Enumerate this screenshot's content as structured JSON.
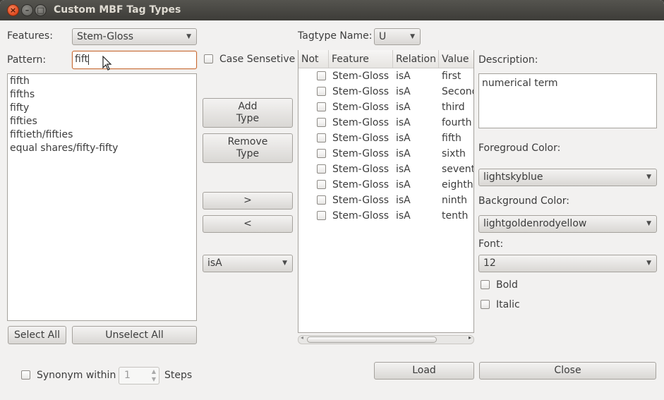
{
  "window": {
    "title": "Custom MBF Tag Types"
  },
  "features": {
    "label": "Features:",
    "value": "Stem-Gloss"
  },
  "pattern": {
    "label": "Pattern:",
    "value": "fift"
  },
  "case_sensitive": {
    "label": "Case Sensetive"
  },
  "matches": [
    "fifth",
    "fifths",
    "fifty",
    "fifties",
    "fiftieth/fifties",
    "equal shares/fifty-fifty"
  ],
  "buttons": {
    "add_type": [
      "Add",
      "Type"
    ],
    "remove_type": [
      "Remove",
      "Type"
    ],
    "move_right": ">",
    "move_left": "<",
    "select_all": "Select All",
    "unselect_all": "Unselect All",
    "load": "Load",
    "close": "Close"
  },
  "relation_combo": {
    "value": "isA"
  },
  "tagtype": {
    "label": "Tagtype Name:",
    "value": "U"
  },
  "table": {
    "columns": [
      "Not",
      "Feature",
      "Relation",
      "Value"
    ],
    "rows": [
      {
        "feature": "Stem-Gloss",
        "relation": "isA",
        "value": "first"
      },
      {
        "feature": "Stem-Gloss",
        "relation": "isA",
        "value": "Second"
      },
      {
        "feature": "Stem-Gloss",
        "relation": "isA",
        "value": "third"
      },
      {
        "feature": "Stem-Gloss",
        "relation": "isA",
        "value": "fourth"
      },
      {
        "feature": "Stem-Gloss",
        "relation": "isA",
        "value": "fifth"
      },
      {
        "feature": "Stem-Gloss",
        "relation": "isA",
        "value": "sixth"
      },
      {
        "feature": "Stem-Gloss",
        "relation": "isA",
        "value": "seventh"
      },
      {
        "feature": "Stem-Gloss",
        "relation": "isA",
        "value": "eighth"
      },
      {
        "feature": "Stem-Gloss",
        "relation": "isA",
        "value": "ninth"
      },
      {
        "feature": "Stem-Gloss",
        "relation": "isA",
        "value": "tenth"
      }
    ]
  },
  "description": {
    "label": "Description:",
    "value": "numerical term"
  },
  "foreground": {
    "label": "Foregroud Color:",
    "value": "lightskyblue"
  },
  "background": {
    "label": "Background Color:",
    "value": "lightgoldenrodyellow"
  },
  "font": {
    "label": "Font:",
    "value": "12"
  },
  "bold": {
    "label": "Bold"
  },
  "italic": {
    "label": "Italic"
  },
  "synonym": {
    "label": "Synonym within",
    "value": "1",
    "suffix": "Steps"
  },
  "colors": {
    "accent_border": "#c66a34",
    "window_bg": "#f2f1f0",
    "titlebar": "#3d3c38"
  },
  "icons": {
    "close": "close-icon",
    "minimize": "minimize-icon",
    "maximize": "maximize-icon",
    "arrow": "chevron-down-icon"
  }
}
